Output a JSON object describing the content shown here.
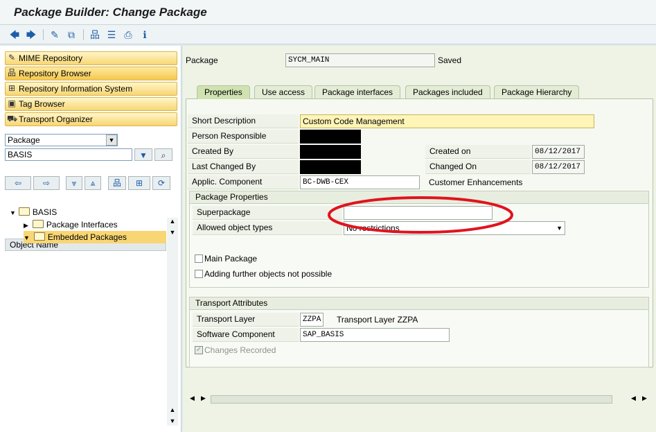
{
  "window": {
    "title": "Package Builder: Change Package"
  },
  "toolbar": {
    "icons": [
      "back-arrow-icon",
      "forward-arrow-icon",
      "edit-pencil-icon",
      "other-object-icon",
      "hierarchy-icon",
      "list-icon",
      "printer-icon",
      "info-icon"
    ],
    "glyphs": [
      "🡄",
      "🡆",
      "✎",
      "⧉",
      "品",
      "☰",
      "⎙",
      "ℹ"
    ]
  },
  "left": {
    "nav": [
      {
        "label": "MIME Repository",
        "glyph": "✎"
      },
      {
        "label": "Repository Browser",
        "glyph": "品"
      },
      {
        "label": "Repository Information System",
        "glyph": "⊞"
      },
      {
        "label": "Tag Browser",
        "glyph": "▣"
      },
      {
        "label": "Transport Organizer",
        "glyph": "⛟"
      }
    ],
    "object_type": "Package",
    "object_name": "BASIS",
    "tree_header": "Object Name",
    "tree": {
      "root": "BASIS",
      "child1": "Package Interfaces",
      "child2": "Embedded Packages"
    }
  },
  "header": {
    "package_label": "Package",
    "package_value": "SYCM_MAIN",
    "status": "Saved"
  },
  "tabs": [
    "Properties",
    "Use access",
    "Package interfaces",
    "Packages included",
    "Package Hierarchy"
  ],
  "properties": {
    "short_desc_label": "Short Description",
    "short_desc_value": "Custom Code Management",
    "person_resp_label": "Person Responsible",
    "created_by_label": "Created By",
    "created_on_label": "Created on",
    "created_on_value": "08/12/2017",
    "last_changed_by_label": "Last Changed By",
    "changed_on_label": "Changed On",
    "changed_on_value": "08/12/2017",
    "applic_comp_label": "Applic. Component",
    "applic_comp_value": "BC-DWB-CEX",
    "applic_comp_desc": "Customer Enhancements"
  },
  "package_properties": {
    "title": "Package Properties",
    "superpackage_label": "Superpackage",
    "superpackage_value": "",
    "allowed_types_label": "Allowed object types",
    "allowed_types_value": "No restrictions",
    "main_package_label": "Main Package",
    "adding_label": "Adding further objects not possible"
  },
  "transport": {
    "title": "Transport Attributes",
    "layer_label": "Transport Layer",
    "layer_value": "ZZPA",
    "layer_desc": "Transport Layer ZZPA",
    "sw_comp_label": "Software Component",
    "sw_comp_value": "SAP_BASIS",
    "changes_recorded_label": "Changes Recorded"
  },
  "colors": {
    "annotation_ellipse": "#e0141e",
    "nav_button": "#f8d673"
  }
}
